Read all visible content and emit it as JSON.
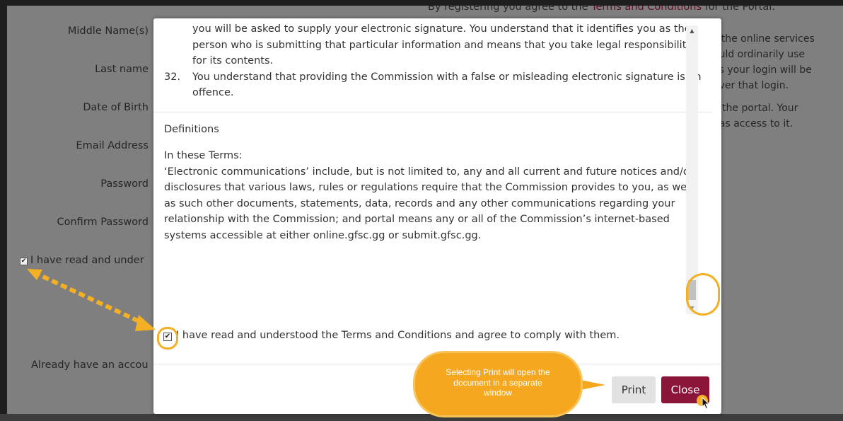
{
  "background_form": {
    "top_note_prefix": "By registering you agree to the ",
    "top_note_link": "Terms and Conditions",
    "top_note_suffix": " for the Portal.",
    "labels": {
      "middle_name": "Middle Name(s)",
      "last_name": "Last name",
      "dob": "Date of Birth",
      "email": "Email Address",
      "password": "Password",
      "confirm_password": "Confirm Password"
    },
    "agree_text": "I have read and under",
    "already_text": "Already have an accou",
    "right_lines": [
      "s the online services",
      "ould ordinarily use",
      "as your login will be",
      " over that login.",
      "",
      "o the portal. Your",
      " has access to it."
    ]
  },
  "modal": {
    "cut_line": "you will be asked to supply your electronic signature. You understand that it identifies you as the person who is submitting that particular information and means that you take legal responsibility for its contents.",
    "clause_32_num": "32.",
    "clause_32_text": "You understand that providing the Commission with a false or misleading electronic signature is an offence.",
    "definitions_heading": "Definitions",
    "definitions_intro": "In these Terms:",
    "definitions_body": "‘Electronic communications’ include, but is not limited to, any and all current and future notices and/or disclosures that various laws, rules or regulations require that the Commission provides to you, as well as such other documents, statements, data, records and any other communications regarding your relationship with the Commission; and portal means any or all of the Commission’s internet-based systems accessible at either online.gfsc.gg or submit.gfsc.gg.",
    "agree_checkbox_label": "I have read and understood the Terms and Conditions and agree to comply with them.",
    "print_label": "Print",
    "close_label": "Close"
  },
  "tooltip": {
    "text": "Selecting Print will open the document in a separate window"
  },
  "colors": {
    "accent": "#8b1538",
    "highlight": "#f4b024",
    "tooltip": "#f4a71f",
    "overlay": "#7f7f7f"
  }
}
